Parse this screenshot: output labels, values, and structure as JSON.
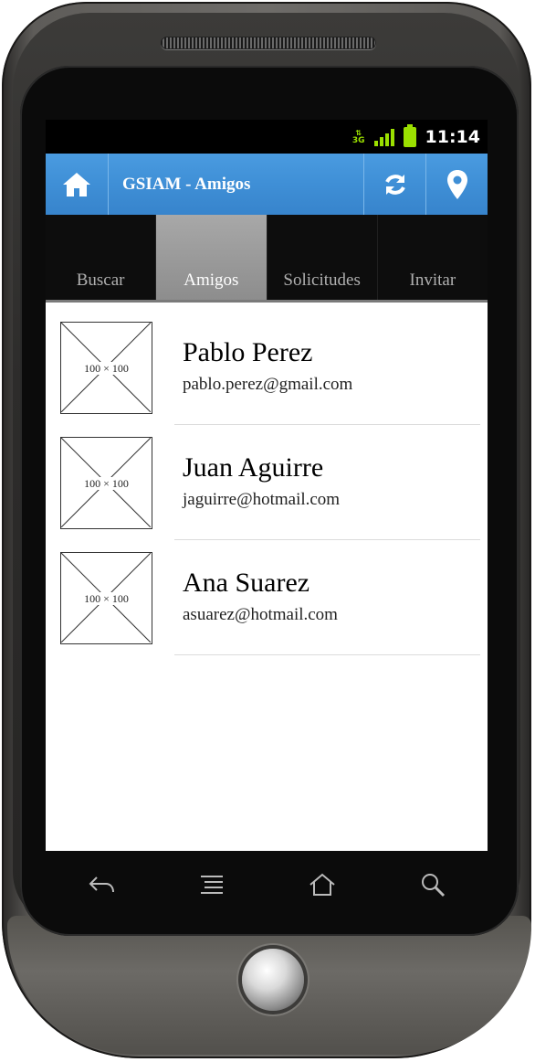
{
  "status_bar": {
    "network": "3G",
    "time": "11:14"
  },
  "action_bar": {
    "title": "GSIAM - Amigos",
    "accent_color": "#3f8fd6"
  },
  "tabs": [
    {
      "label": "Buscar",
      "active": false
    },
    {
      "label": "Amigos",
      "active": true
    },
    {
      "label": "Solicitudes",
      "active": false
    },
    {
      "label": "Invitar",
      "active": false
    }
  ],
  "friends": [
    {
      "thumb": "100 × 100",
      "name": "Pablo Perez",
      "email": "pablo.perez@gmail.com"
    },
    {
      "thumb": "100 × 100",
      "name": "Juan Aguirre",
      "email": "jaguirre@hotmail.com"
    },
    {
      "thumb": "100 × 100",
      "name": "Ana Suarez",
      "email": "asuarez@hotmail.com"
    }
  ],
  "icons": {
    "home": "home-icon",
    "refresh": "refresh-icon",
    "location": "location-pin-icon",
    "back": "back-icon",
    "menu": "menu-icon",
    "home_key": "home-key-icon",
    "search": "search-icon"
  }
}
